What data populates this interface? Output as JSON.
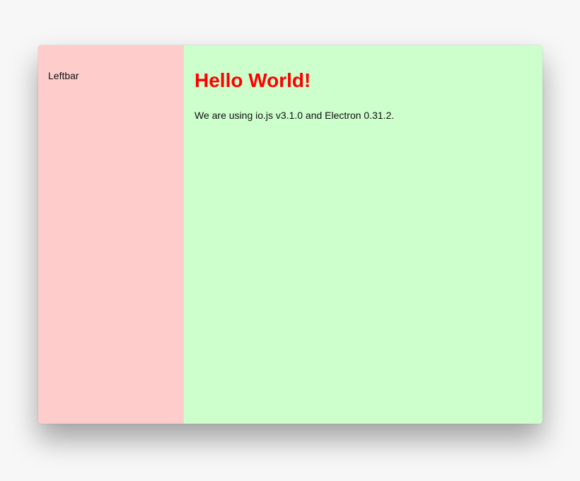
{
  "leftbar": {
    "label": "Leftbar",
    "background": "#ffcccc"
  },
  "main": {
    "title": "Hello World!",
    "title_color": "#ff0000",
    "message": "We are using io.js v3.1.0 and Electron 0.31.2.",
    "background": "#ccffcc"
  }
}
